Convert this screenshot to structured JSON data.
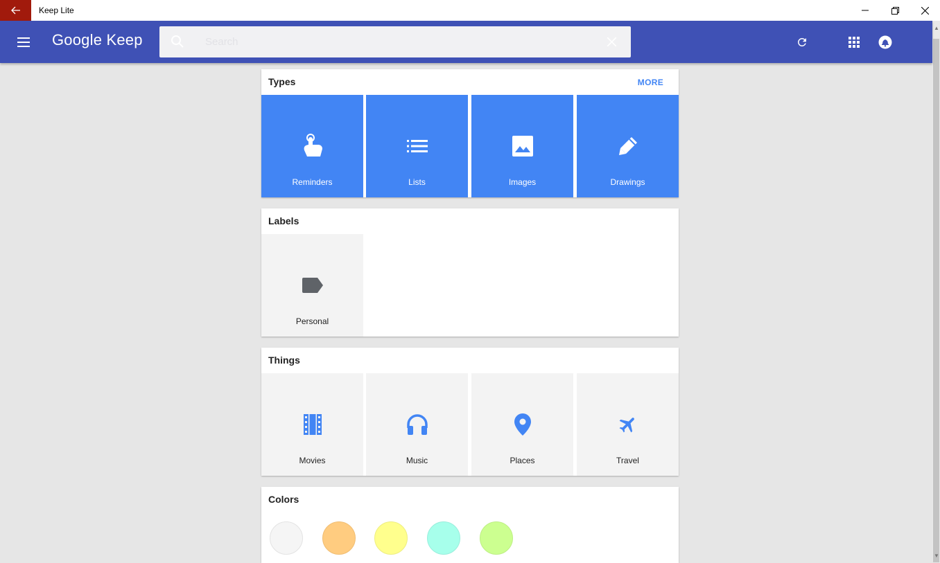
{
  "window": {
    "title": "Keep Lite",
    "back_icon": "arrow-left-icon",
    "minimize_icon": "minimize-icon",
    "restore_icon": "restore-icon",
    "close_icon": "close-icon"
  },
  "appbar": {
    "brand": "Google Keep",
    "color": "#3f51b5",
    "search_placeholder": "Search",
    "icons": [
      "menu-icon",
      "refresh-icon",
      "apps-grid-icon",
      "account-icon"
    ]
  },
  "types": {
    "title": "Types",
    "more_label": "MORE",
    "tile_color": "#4285f4",
    "items": [
      {
        "label": "Reminders",
        "icon": "reminder-finger-icon"
      },
      {
        "label": "Lists",
        "icon": "list-icon"
      },
      {
        "label": "Images",
        "icon": "image-icon"
      },
      {
        "label": "Drawings",
        "icon": "pen-icon"
      }
    ]
  },
  "labels": {
    "title": "Labels",
    "items": [
      {
        "label": "Personal",
        "icon": "label-tag-icon"
      }
    ]
  },
  "things": {
    "title": "Things",
    "items": [
      {
        "label": "Movies",
        "icon": "film-icon"
      },
      {
        "label": "Music",
        "icon": "headphones-icon"
      },
      {
        "label": "Places",
        "icon": "place-pin-icon"
      },
      {
        "label": "Travel",
        "icon": "airplane-icon"
      }
    ]
  },
  "colors": {
    "title": "Colors",
    "swatches": [
      "#f5f5f5",
      "#ffcc80",
      "#ffff8d",
      "#a7ffeb",
      "#ccff90"
    ]
  }
}
